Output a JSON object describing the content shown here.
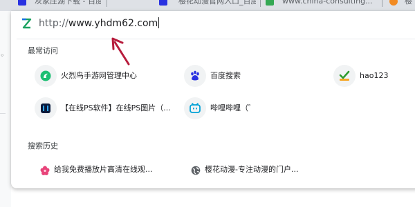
{
  "tabs": [
    {
      "title": "灰家庄湖下载 - 百度"
    },
    {
      "title": "樱花动漫官网入口_百度"
    },
    {
      "title": "www.china-consulting..."
    },
    {
      "title": "樱"
    }
  ],
  "omnibox": {
    "url_scheme": "http://",
    "url_host": "www.yhdm62.com"
  },
  "dropdown": {
    "frequent_title": "最常访问",
    "history_title": "搜索历史",
    "frequent": [
      {
        "label": "火烈鸟手游网管理中心",
        "icon": "flamingo-icon"
      },
      {
        "label": "百度搜索",
        "icon": "baidu-paw-icon"
      },
      {
        "label": "hao123",
        "icon": "hao123-icon"
      },
      {
        "label": "【在线PS软件】在线PS图片（...",
        "icon": "ps-online-icon"
      },
      {
        "label": "哔哩哔哩（゜",
        "icon": "bilibili-icon"
      }
    ],
    "history": [
      {
        "label": "给我免费播放片高清在线观...",
        "icon": "sakura-flower-icon"
      },
      {
        "label": "樱花动漫-专注动漫的门户...",
        "icon": "globe-icon"
      }
    ]
  },
  "colors": {
    "accent": "#1a73e8",
    "arrow": "#b71c3c"
  }
}
